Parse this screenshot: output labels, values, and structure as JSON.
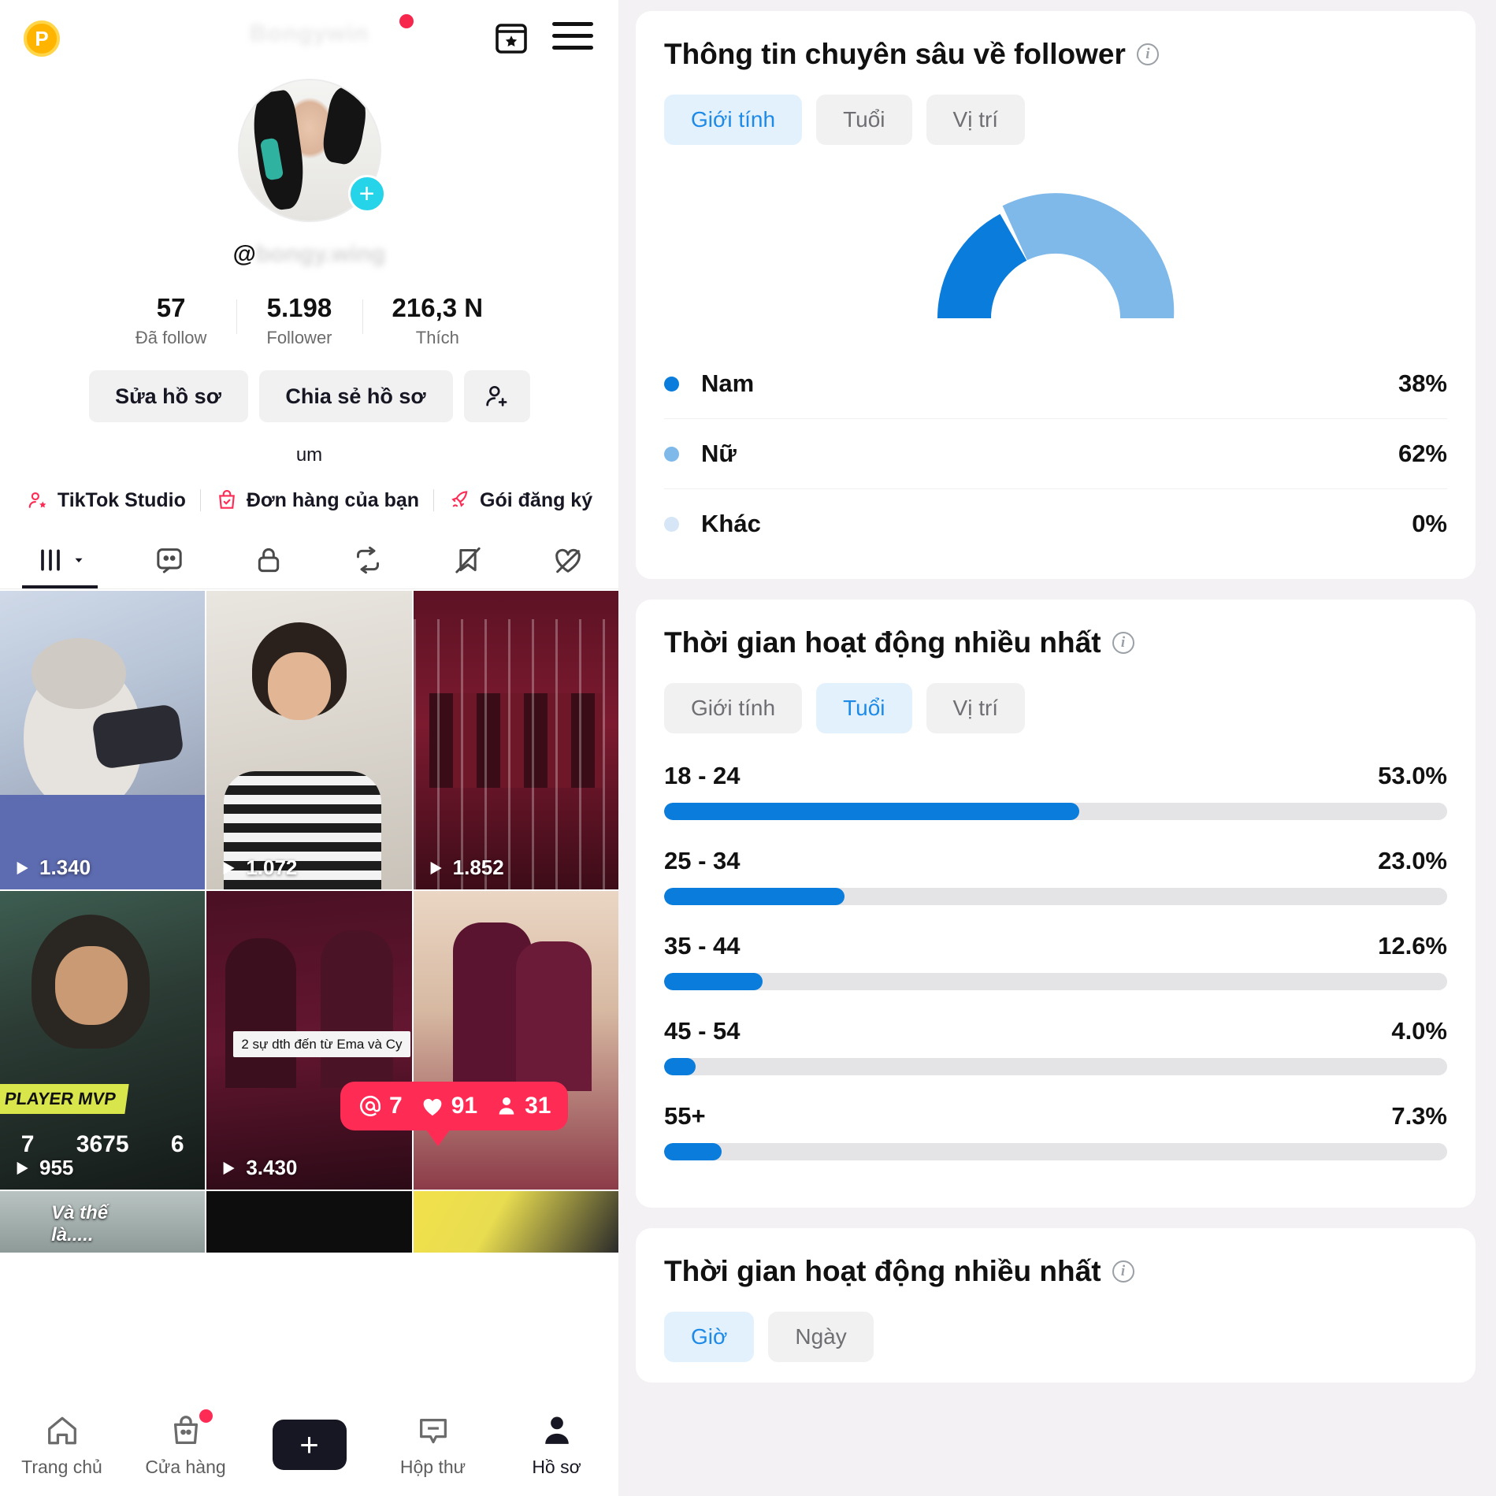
{
  "profile": {
    "badge_letter": "P",
    "username_blurred": "Bongywin",
    "handle_at": "@",
    "handle_blurred": "bongy.wing",
    "bio": "um",
    "stats": [
      {
        "value": "57",
        "label": "Đã follow"
      },
      {
        "value": "5.198",
        "label": "Follower"
      },
      {
        "value": "216,3 N",
        "label": "Thích"
      }
    ],
    "actions": {
      "edit": "Sửa hồ sơ",
      "share": "Chia sẻ hồ sơ",
      "add_user_icon": "add-user-icon"
    },
    "links": [
      {
        "label": "TikTok Studio",
        "icon": "user-star-icon"
      },
      {
        "label": "Đơn hàng của bạn",
        "icon": "shopping-bag-check-icon"
      },
      {
        "label": "Gói đăng ký",
        "icon": "rocket-icon"
      }
    ],
    "tabs": [
      {
        "name": "posts-tab",
        "icon": "grid-lines-icon",
        "active": true
      },
      {
        "name": "reposts-tab",
        "icon": "sticker-icon",
        "active": false
      },
      {
        "name": "private-tab",
        "icon": "lock-icon",
        "active": false
      },
      {
        "name": "repost-tab",
        "icon": "repost-icon",
        "active": false
      },
      {
        "name": "hidden-tab",
        "icon": "bookmark-off-icon",
        "active": false
      },
      {
        "name": "liked-tab",
        "icon": "heart-off-icon",
        "active": false
      }
    ]
  },
  "grid": [
    {
      "plays": "1.340",
      "caption": ""
    },
    {
      "plays": "1.072",
      "caption": ""
    },
    {
      "plays": "1.852",
      "caption": ""
    },
    {
      "plays": "955",
      "caption": "PLAYER MVP",
      "hud": [
        "7",
        "3675",
        "6"
      ]
    },
    {
      "plays": "3.430",
      "caption": "2 sự dth đến từ\nEma và Cy"
    },
    {
      "plays": "",
      "caption": ""
    }
  ],
  "grid_row3": {
    "caption": "Và thế là....."
  },
  "tooltip": {
    "mentions_icon": "at-icon",
    "mentions": "7",
    "likes_icon": "heart-icon",
    "likes": "91",
    "followers_icon": "person-icon",
    "followers": "31"
  },
  "bottom_nav": [
    {
      "label": "Trang chủ",
      "icon": "home-icon",
      "active": false,
      "badge": false
    },
    {
      "label": "Cửa hàng",
      "icon": "shop-bag-icon",
      "active": false,
      "badge": true
    },
    {
      "label": "",
      "icon": "create-plus-icon",
      "active": false,
      "badge": false
    },
    {
      "label": "Hộp thư",
      "icon": "message-icon",
      "active": false,
      "badge": false
    },
    {
      "label": "Hồ sơ",
      "icon": "profile-person-icon",
      "active": true,
      "badge": false
    }
  ],
  "analytics": {
    "follower_insights": {
      "title": "Thông tin chuyên sâu về follower",
      "segments": [
        {
          "label": "Giới tính",
          "active": true
        },
        {
          "label": "Tuổi",
          "active": false
        },
        {
          "label": "Vị trí",
          "active": false
        }
      ]
    },
    "most_active_age": {
      "title": "Thời gian hoạt động nhiều nhất",
      "segments": [
        {
          "label": "Giới tính",
          "active": false
        },
        {
          "label": "Tuổi",
          "active": true
        },
        {
          "label": "Vị trí",
          "active": false
        }
      ]
    },
    "most_active_time": {
      "title": "Thời gian hoạt động nhiều nhất",
      "segments": [
        {
          "label": "Giờ",
          "active": true
        },
        {
          "label": "Ngày",
          "active": false
        }
      ]
    }
  },
  "colors": {
    "male_blue": "#0A7CDC",
    "female_blue": "#7FB9EA",
    "other_blue": "#D6E6F6",
    "accent_pink": "#FE2C55",
    "seg_active_bg": "#E3F1FD",
    "seg_active_text": "#1D8AE8",
    "bar_track": "#E4E4E6"
  },
  "chart_data": [
    {
      "type": "pie",
      "title": "Thông tin chuyên sâu về follower",
      "subtitle": "Giới tính",
      "legend_position": "bottom",
      "labels": [
        "Nam",
        "Nữ",
        "Khác"
      ],
      "values": [
        38,
        62,
        0
      ],
      "value_labels": [
        "38%",
        "62%",
        "0%"
      ],
      "colors": [
        "#0A7CDC",
        "#7FB9EA",
        "#D6E6F6"
      ],
      "note": "semi-circular donut gauge"
    },
    {
      "type": "bar",
      "title": "Thời gian hoạt động nhiều nhất",
      "subtitle": "Tuổi",
      "orientation": "horizontal",
      "categories": [
        "18 - 24",
        "25 - 34",
        "35 - 44",
        "45 - 54",
        "55+"
      ],
      "values": [
        53.0,
        23.0,
        12.6,
        4.0,
        7.3
      ],
      "value_labels": [
        "53.0%",
        "23.0%",
        "12.6%",
        "4.0%",
        "7.3%"
      ],
      "xlabel": "",
      "ylabel": "",
      "xlim": [
        0,
        100
      ],
      "grid": false,
      "color": "#0A7CDC"
    }
  ]
}
